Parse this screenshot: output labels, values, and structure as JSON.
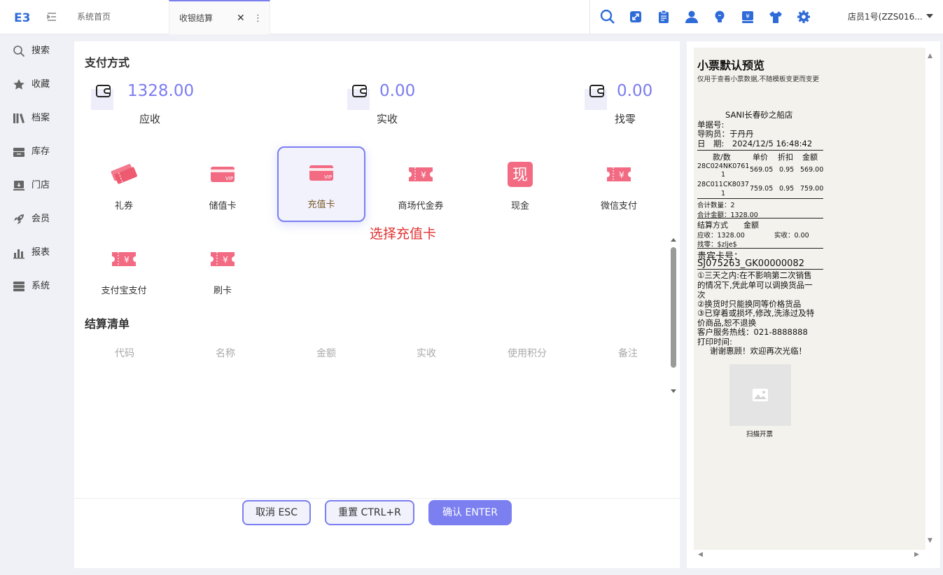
{
  "app": {
    "logo_text": "E3"
  },
  "tabs": [
    {
      "label": "系统首页"
    },
    {
      "label": "收银结算",
      "close": "✕",
      "more": "⋮"
    }
  ],
  "toolbar_icons": [
    "search-icon",
    "expand-icon",
    "clipboard-icon",
    "user-icon",
    "bulb-icon",
    "cashier-icon",
    "shirt-icon",
    "gear-icon"
  ],
  "user": {
    "name": "店员1号(ZZS016..."
  },
  "sidebar": {
    "items": [
      {
        "label": "搜索",
        "icon": "search-icon"
      },
      {
        "label": "收藏",
        "icon": "star-icon"
      },
      {
        "label": "档案",
        "icon": "books-icon"
      },
      {
        "label": "库存",
        "icon": "inventory-icon"
      },
      {
        "label": "门店",
        "icon": "store-icon"
      },
      {
        "label": "会员",
        "icon": "rocket-icon"
      },
      {
        "label": "报表",
        "icon": "chart-icon"
      },
      {
        "label": "系统",
        "icon": "server-icon"
      }
    ]
  },
  "payment": {
    "section_title": "支付方式",
    "amounts": [
      {
        "value": "1328.00",
        "label": "应收"
      },
      {
        "value": "0.00",
        "label": "实收"
      },
      {
        "value": "0.00",
        "label": "找零"
      }
    ],
    "methods": [
      {
        "label": "礼券"
      },
      {
        "label": "储值卡"
      },
      {
        "label": "充值卡",
        "selected": true
      },
      {
        "label": "商场代金券"
      },
      {
        "label": "现金",
        "glyph": "现"
      },
      {
        "label": "微信支付"
      },
      {
        "label": "支付宝支付"
      },
      {
        "label": "刷卡"
      }
    ],
    "annotation": "选择充值卡"
  },
  "settlement": {
    "section_title": "结算清单",
    "columns": [
      "代码",
      "名称",
      "金额",
      "实收",
      "使用积分",
      "备注"
    ]
  },
  "buttons": {
    "cancel": "取消 ESC",
    "reset": "重置 CTRL+R",
    "confirm": "确认 ENTER"
  },
  "colors": {
    "accent": "#7b7ff0",
    "pay_icon": "#f26b83",
    "annotation": "#e03131"
  },
  "receipt": {
    "title": "小票默认预览",
    "subtitle": "仅用于查看小票数据,不随模板变更而变更",
    "store": "SANI长春砂之船店",
    "doc_no": "单据号:",
    "guide": "导购员：于丹丹",
    "date": "日　期:　2024/12/5 16:48:42",
    "header": {
      "col1": "款/数",
      "col2": "单价",
      "col3": "折扣",
      "col4": "金额"
    },
    "items": [
      {
        "code": "28C024NK0761",
        "qty": "1",
        "price": "569.05",
        "disc": "0.95",
        "amount": "569.00"
      },
      {
        "code": "28C011CK8037",
        "qty": "1",
        "price": "759.05",
        "disc": "0.95",
        "amount": "759.00"
      }
    ],
    "total_qty": "合计数量：2",
    "total_amt": "合计金额：1328.00",
    "pay_header": "结算方式　　金额",
    "receivable": "应收：1328.00",
    "received": "实收：0.00",
    "change": "找零：$zlje$",
    "vip_label": "贵宾卡号：",
    "vip_no": "SJ075263_GK00000082",
    "notes": [
      "①三天之内:在不影响第二次销售",
      "的情况下,凭此单可以调换货品一",
      "次",
      "②换货时只能换同等价格货品",
      "③已穿着或损坏,修改,洗涤过及特",
      "价商品,恕不退换"
    ],
    "hotline": "客户服务热线：021-8888888",
    "print_time": "打印时间:",
    "thanks": "谢谢惠顾！欢迎再次光临！",
    "qr_caption": "扫描开票"
  }
}
